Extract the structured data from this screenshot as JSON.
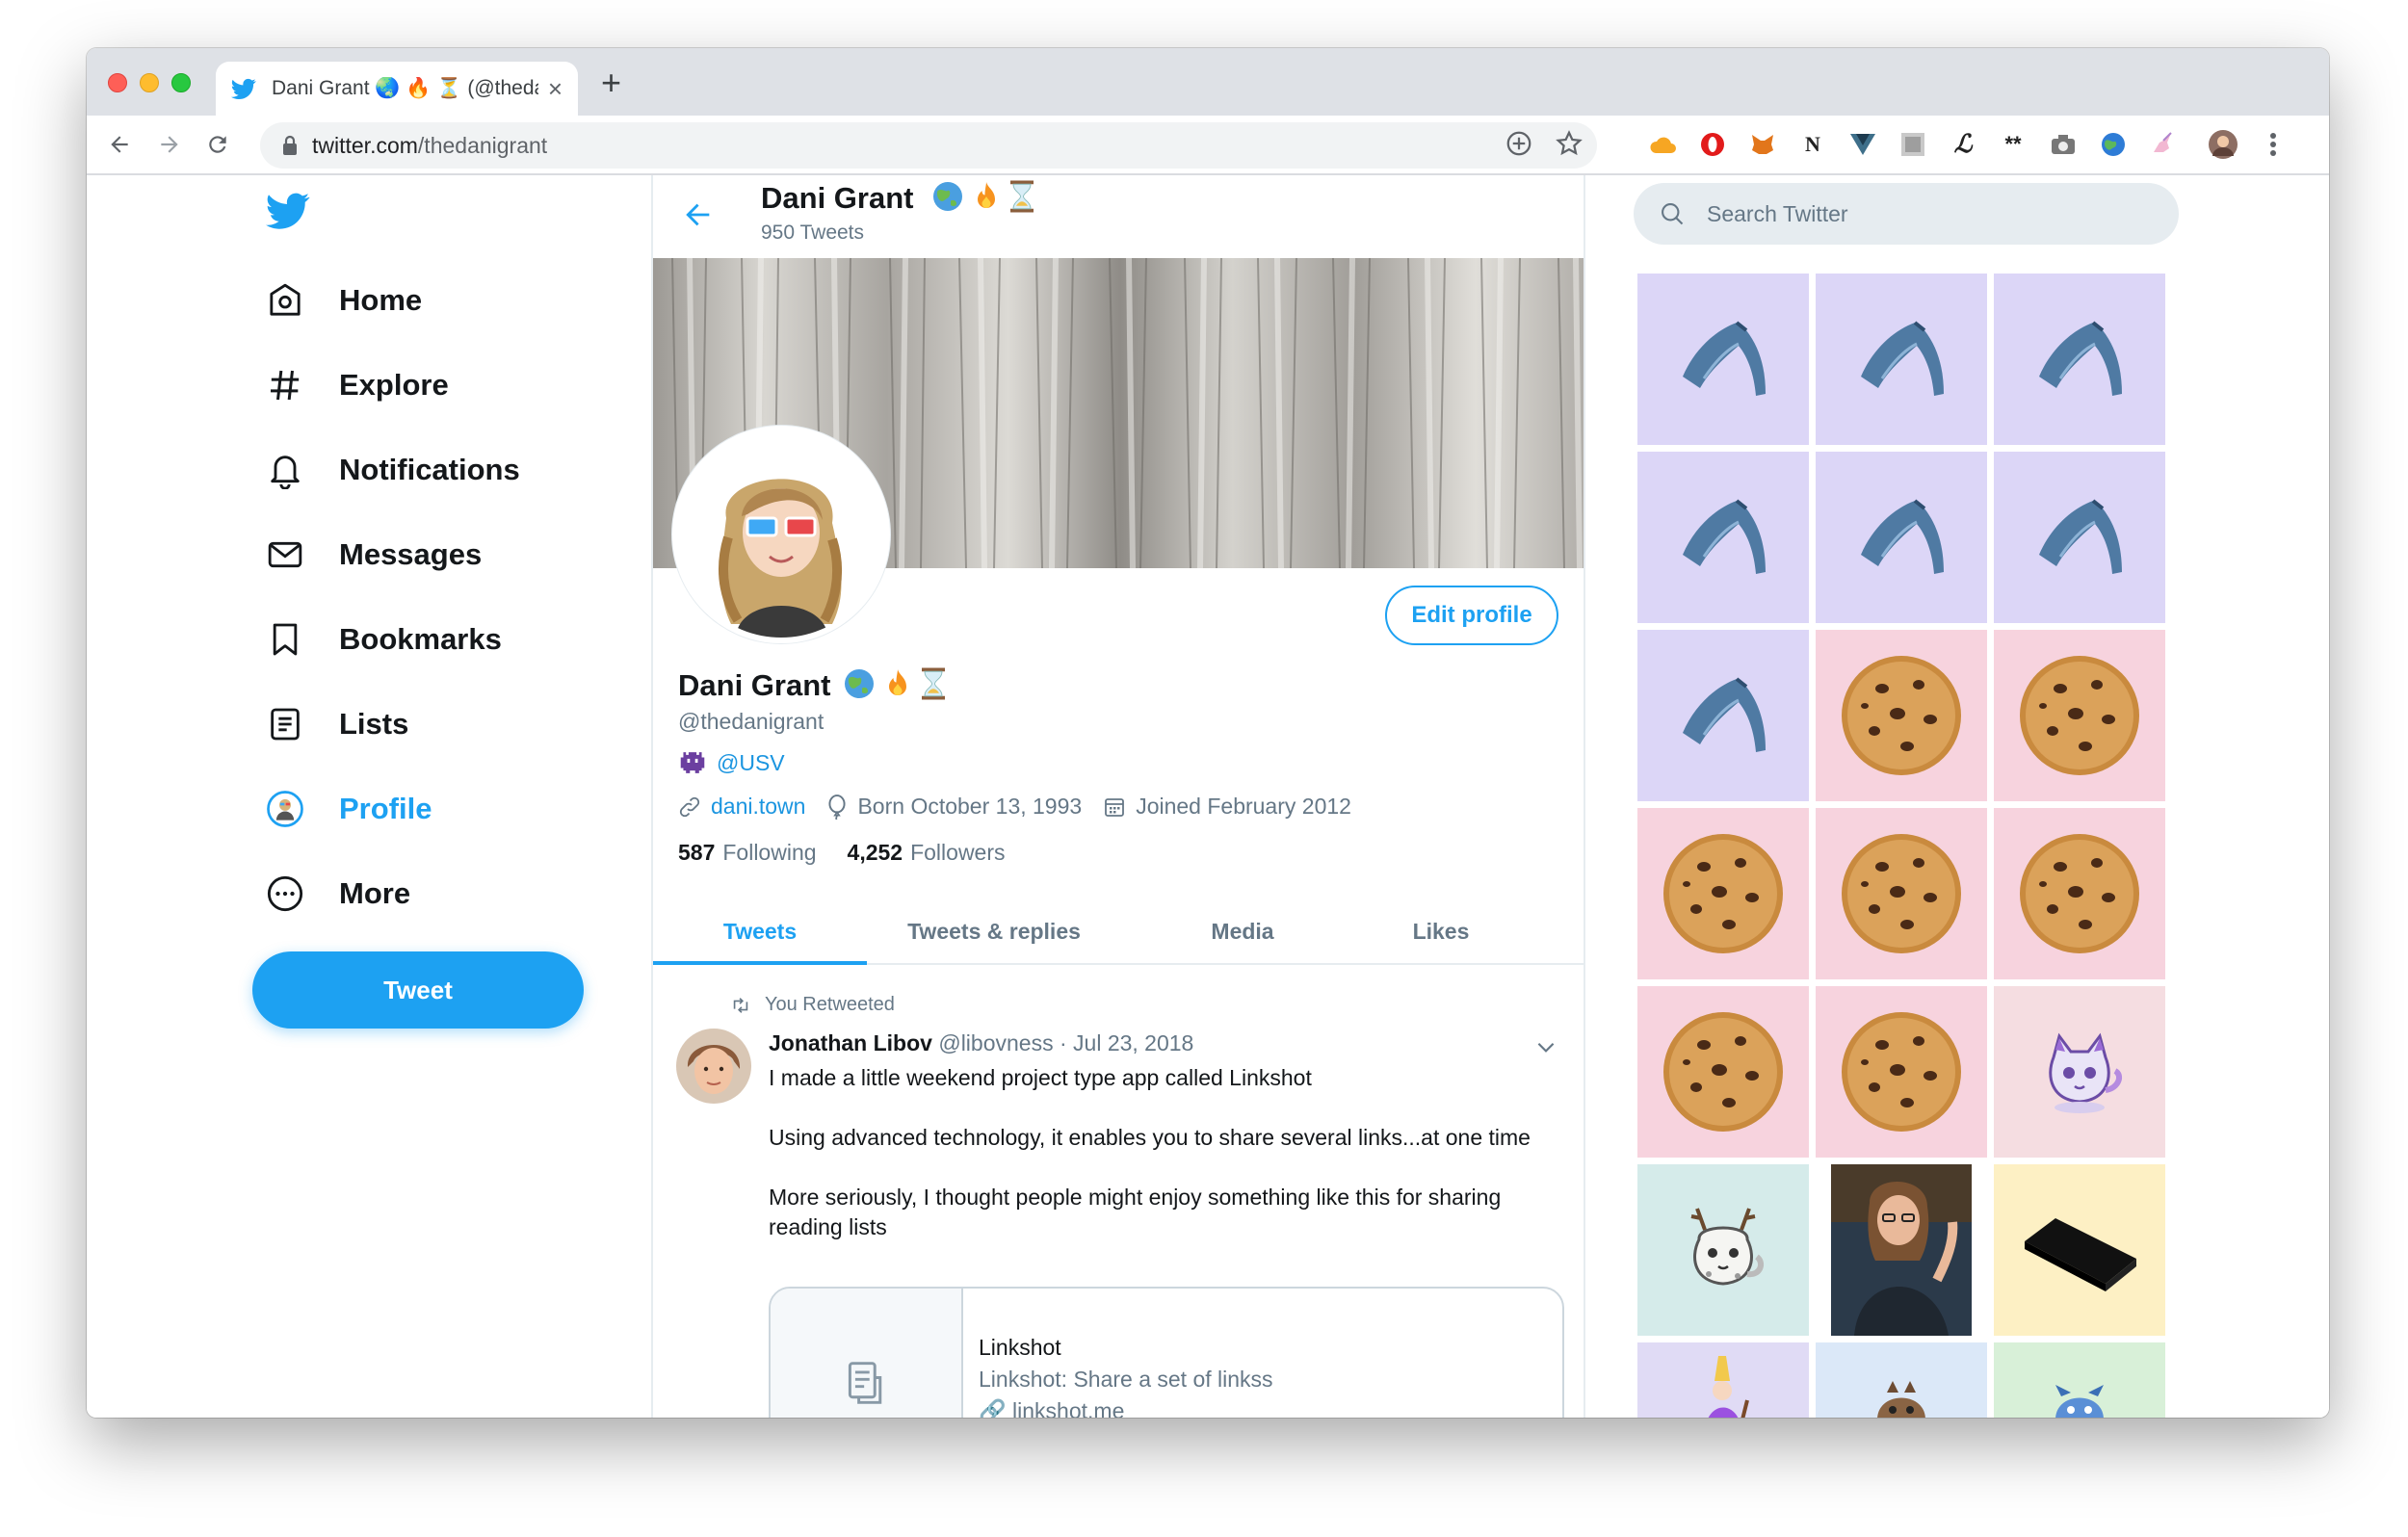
{
  "browser": {
    "tab_title": "Dani Grant 🌏 🔥 ⏳ (@thedan",
    "url_host": "twitter.com",
    "url_path": "/thedanigrant"
  },
  "sidebar": {
    "items": [
      {
        "label": "Home",
        "icon": "home-icon"
      },
      {
        "label": "Explore",
        "icon": "hashtag-icon"
      },
      {
        "label": "Notifications",
        "icon": "bell-icon"
      },
      {
        "label": "Messages",
        "icon": "envelope-icon"
      },
      {
        "label": "Bookmarks",
        "icon": "bookmark-icon"
      },
      {
        "label": "Lists",
        "icon": "list-icon"
      },
      {
        "label": "Profile",
        "icon": "profile-avatar-icon",
        "active": true
      },
      {
        "label": "More",
        "icon": "more-icon"
      }
    ],
    "tweet_button": "Tweet"
  },
  "header": {
    "name": "Dani Grant",
    "tweet_count": "950 Tweets"
  },
  "profile": {
    "name": "Dani Grant",
    "handle": "@thedanigrant",
    "bio_mention": "@USV",
    "website": "dani.town",
    "born": "Born October 13, 1993",
    "joined": "Joined February 2012",
    "following_count": "587",
    "following_label": "Following",
    "followers_count": "4,252",
    "followers_label": "Followers",
    "edit_button": "Edit profile"
  },
  "tabs": [
    "Tweets",
    "Tweets & replies",
    "Media",
    "Likes"
  ],
  "tweet": {
    "retweet_label": "You Retweeted",
    "author_name": "Jonathan Libov",
    "author_handle": "@libovness",
    "date": "Jul 23, 2018",
    "paragraphs": [
      "I made a little weekend project type app called Linkshot",
      "Using advanced technology, it enables you to share several links...at one time",
      "More seriously, I thought people might enjoy something like this for sharing reading lists"
    ],
    "card": {
      "title": "Linkshot",
      "description": "Linkshot: Share a set of linkss",
      "url": "linkshot.me"
    }
  },
  "search": {
    "placeholder": "Search Twitter"
  },
  "colors": {
    "twitter_blue": "#1da1f2",
    "link_blue": "#1b95e0",
    "muted_gray": "#657786"
  }
}
